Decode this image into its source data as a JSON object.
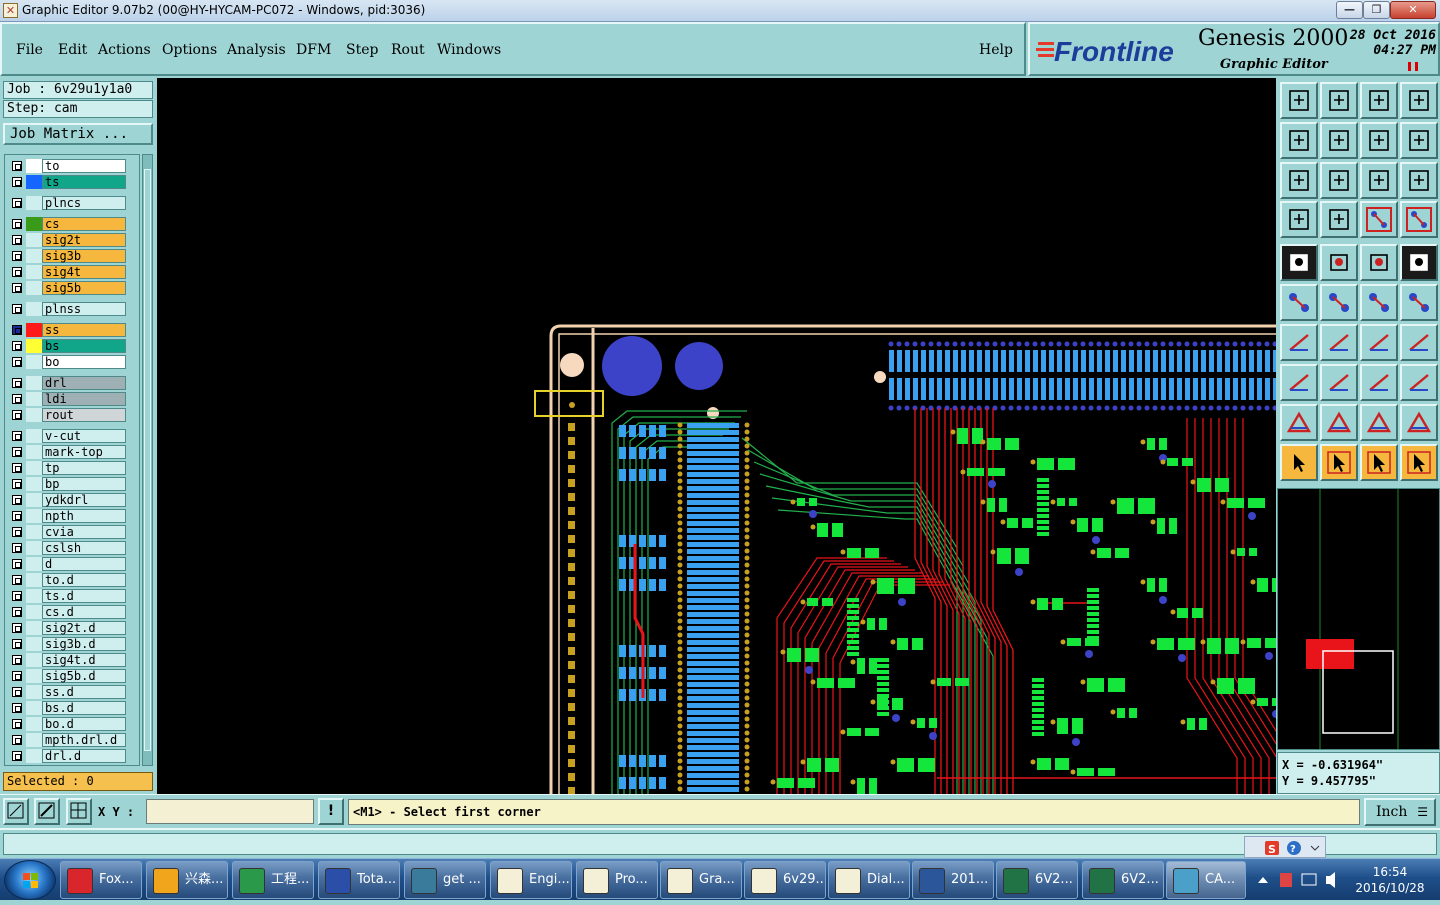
{
  "window": {
    "title": "Graphic Editor 9.07b2 (00@HY-HYCAM-PC072 - Windows, pid:3036)",
    "minimize_glyph": "—",
    "restore_glyph": "❐",
    "close_glyph": "✕"
  },
  "menu": {
    "items": [
      "File",
      "Edit",
      "Actions",
      "Options",
      "Analysis",
      "DFM",
      "Step",
      "Rout",
      "Windows"
    ],
    "help": "Help"
  },
  "branding": {
    "logo": "Frontline",
    "product": "Genesis 2000",
    "subtitle": "Graphic Editor",
    "date": "28 Oct 2016",
    "time": "04:27 PM"
  },
  "job": {
    "job_label": "Job : 6v29u1y1a0",
    "step_label": "Step: cam",
    "matrix_button": "Job Matrix ..."
  },
  "layers": [
    {
      "name": "to",
      "swatch": "#ffffff",
      "bg": "#ffffff",
      "gap": 0
    },
    {
      "name": "ts",
      "swatch": "#1565ff",
      "bg": "#11a58a",
      "gap": 0
    },
    {
      "name": "plncs",
      "swatch": "",
      "bg": "#cfeeee",
      "gap": 1
    },
    {
      "name": "cs",
      "swatch": "#3a9a1a",
      "bg": "#f5b73d",
      "gap": 1
    },
    {
      "name": "sig2t",
      "swatch": "",
      "bg": "#f5b73d",
      "gap": 0
    },
    {
      "name": "sig3b",
      "swatch": "",
      "bg": "#f5b73d",
      "gap": 0
    },
    {
      "name": "sig4t",
      "swatch": "",
      "bg": "#f5b73d",
      "gap": 0
    },
    {
      "name": "sig5b",
      "swatch": "",
      "bg": "#f5b73d",
      "gap": 0
    },
    {
      "name": "plnss",
      "swatch": "",
      "bg": "#cfeeee",
      "gap": 1
    },
    {
      "name": "ss",
      "swatch": "#ff1a1a",
      "bg": "#f5b73d",
      "gap": 1,
      "selected": true
    },
    {
      "name": "bs",
      "swatch": "#ffff33",
      "bg": "#11a58a",
      "gap": 0
    },
    {
      "name": "bo",
      "swatch": "",
      "bg": "#ffffff",
      "gap": 0
    },
    {
      "name": "drl",
      "swatch": "",
      "bg": "#9fb0b5",
      "gap": 1
    },
    {
      "name": "ldi",
      "swatch": "",
      "bg": "#9fb0b5",
      "gap": 0
    },
    {
      "name": "rout",
      "swatch": "",
      "bg": "#d0d6d8",
      "gap": 0
    },
    {
      "name": "v-cut",
      "swatch": "",
      "bg": "#cfeeee",
      "gap": 1
    },
    {
      "name": "mark-top",
      "swatch": "",
      "bg": "#cfeeee",
      "gap": 0
    },
    {
      "name": "tp",
      "swatch": "",
      "bg": "#cfeeee",
      "gap": 0
    },
    {
      "name": "bp",
      "swatch": "",
      "bg": "#cfeeee",
      "gap": 0
    },
    {
      "name": "ydkdrl",
      "swatch": "",
      "bg": "#cfeeee",
      "gap": 0
    },
    {
      "name": "npth",
      "swatch": "",
      "bg": "#cfeeee",
      "gap": 0
    },
    {
      "name": "cvia",
      "swatch": "",
      "bg": "#cfeeee",
      "gap": 0
    },
    {
      "name": "cslsh",
      "swatch": "",
      "bg": "#cfeeee",
      "gap": 0
    },
    {
      "name": "d",
      "swatch": "",
      "bg": "#cfeeee",
      "gap": 0
    },
    {
      "name": "to.d",
      "swatch": "",
      "bg": "#cfeeee",
      "gap": 0
    },
    {
      "name": "ts.d",
      "swatch": "",
      "bg": "#cfeeee",
      "gap": 0
    },
    {
      "name": "cs.d",
      "swatch": "",
      "bg": "#cfeeee",
      "gap": 0
    },
    {
      "name": "sig2t.d",
      "swatch": "",
      "bg": "#cfeeee",
      "gap": 0
    },
    {
      "name": "sig3b.d",
      "swatch": "",
      "bg": "#cfeeee",
      "gap": 0
    },
    {
      "name": "sig4t.d",
      "swatch": "",
      "bg": "#cfeeee",
      "gap": 0
    },
    {
      "name": "sig5b.d",
      "swatch": "",
      "bg": "#cfeeee",
      "gap": 0
    },
    {
      "name": "ss.d",
      "swatch": "",
      "bg": "#cfeeee",
      "gap": 0
    },
    {
      "name": "bs.d",
      "swatch": "",
      "bg": "#cfeeee",
      "gap": 0
    },
    {
      "name": "bo.d",
      "swatch": "",
      "bg": "#cfeeee",
      "gap": 0
    },
    {
      "name": "mpth.drl.d",
      "swatch": "",
      "bg": "#cfeeee",
      "gap": 0
    },
    {
      "name": "drl.d",
      "swatch": "",
      "bg": "#cfeeee",
      "gap": 0
    }
  ],
  "selection": {
    "label": "Selected : 0"
  },
  "coordinates": {
    "x": "X = -0.631964\"",
    "y": "Y = 9.457795\""
  },
  "bottom": {
    "xy_label": "X Y :",
    "xy_value": "",
    "prompt_icon": "!",
    "prompt": "<M1> - Select first corner",
    "units": "Inch",
    "units_glyph": "☰"
  },
  "toolbox_icons": [
    "zoom-home-icon",
    "zoom-extents-icon",
    "home-view-icon",
    "window-icon",
    "pan-left-icon",
    "pan-right-icon",
    "center-icon",
    "redraw-icon",
    "fit-icon",
    "zoom-center-icon",
    "zoom-1to1-icon",
    "help-icon",
    "measure-icon",
    "grid-icon",
    "layers-net-icon",
    "layers-net-red-icon",
    "single-layer-icon",
    "draw-poly-icon",
    "ruler-icon",
    "pad-icon",
    "net-icon",
    "delete-node-icon",
    "connect-icon",
    "move-node-icon",
    "angle-icon",
    "slant-line-icon",
    "arc-icon",
    "split-icon",
    "snap-icon",
    "line-icon",
    "resize-icon",
    "transform-icon",
    "triangle-icon",
    "triangle-a-icon",
    "triangle-up-icon",
    "triangle-down-icon",
    "pointer-icon",
    "select-box-icon",
    "select-arrow-icon",
    "select-move-icon"
  ],
  "taskbar": {
    "items": [
      {
        "label": "Fox...",
        "icon": "foxit-icon"
      },
      {
        "label": "兴森...",
        "icon": "sunflower-icon"
      },
      {
        "label": "工程...",
        "icon": "p-app-icon"
      },
      {
        "label": "Tota...",
        "icon": "floppy-icon"
      },
      {
        "label": "get ...",
        "icon": "eye-icon"
      },
      {
        "label": "Engi...",
        "icon": "genesis-icon"
      },
      {
        "label": "Pro...",
        "icon": "genesis-icon"
      },
      {
        "label": "Gra...",
        "icon": "genesis-icon"
      },
      {
        "label": "6v29...",
        "icon": "genesis-icon"
      },
      {
        "label": "Dial...",
        "icon": "genesis-icon"
      },
      {
        "label": "201...",
        "icon": "word-icon"
      },
      {
        "label": "6V2...",
        "icon": "excel-icon"
      },
      {
        "label": "6V2...",
        "icon": "excel-icon"
      },
      {
        "label": "CA...",
        "icon": "cam-icon"
      }
    ],
    "clock_time": "16:54",
    "clock_date": "2016/10/28"
  },
  "colors": {
    "panel": "#9ed4d4",
    "canvas": "#000000",
    "layer_red": "#e8141a",
    "layer_green": "#14e63c",
    "layer_blue": "#3aa0f0",
    "layer_gold": "#c8a020"
  }
}
